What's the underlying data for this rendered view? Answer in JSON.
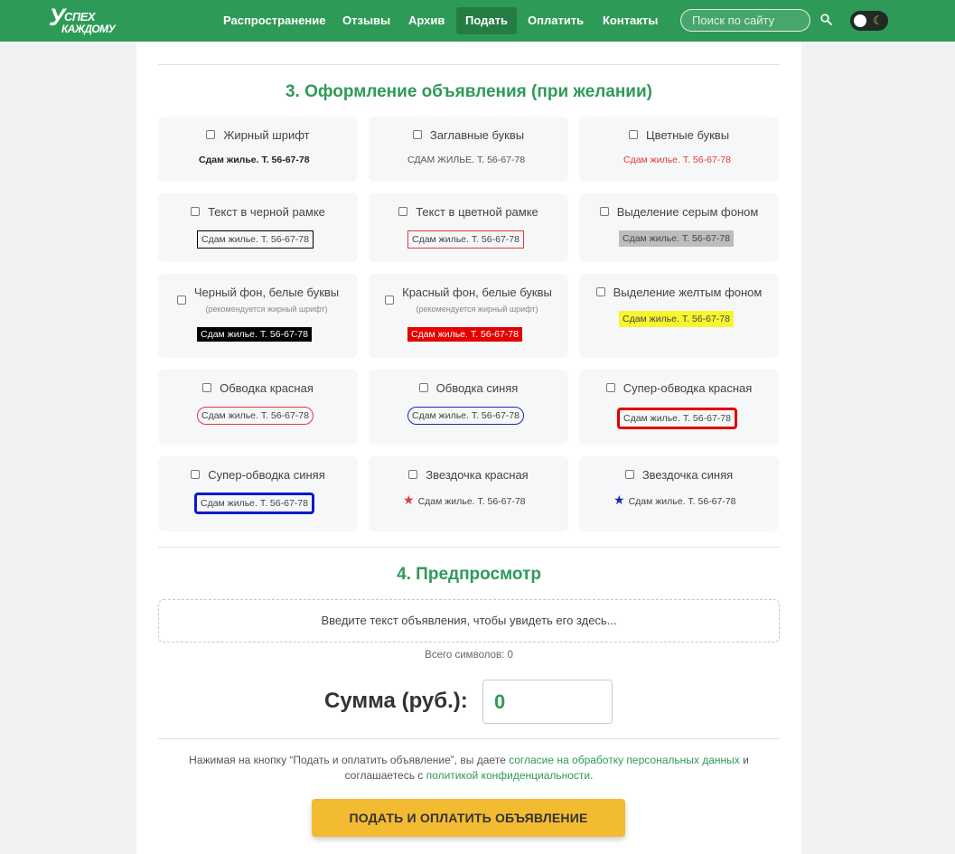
{
  "header": {
    "logo_big": "У",
    "logo_line1": "СПЕХ",
    "logo_line2": "КАЖДОМУ",
    "nav": [
      {
        "label": "Распространение",
        "active": false
      },
      {
        "label": "Отзывы",
        "active": false
      },
      {
        "label": "Архив",
        "active": false
      },
      {
        "label": "Подать",
        "active": true
      },
      {
        "label": "Оплатить",
        "active": false
      },
      {
        "label": "Контакты",
        "active": false
      }
    ],
    "search_placeholder": "Поиск по сайту",
    "search_icon": "magnifier-icon",
    "theme_icon": "moon-icon",
    "theme_toggle_on": false,
    "brand_color": "#2e9a57"
  },
  "design": {
    "title": "3. Оформление объявления (при желании)",
    "sample_text": "Сдам жилье. Т. 56-67-78",
    "sample_upper": "СДАМ ЖИЛЬЕ. Т. 56-67-78",
    "options": [
      {
        "label": "Жирный шрифт",
        "checked": false
      },
      {
        "label": "Заглавные буквы",
        "checked": false
      },
      {
        "label": "Цветные буквы",
        "checked": false
      },
      {
        "label": "Текст в черной рамке",
        "checked": false
      },
      {
        "label": "Текст в цветной рамке",
        "checked": false
      },
      {
        "label": "Выделение серым фоном",
        "checked": false
      },
      {
        "label": "Черный фон, белые буквы",
        "note": "(рекомендуется жирный шрифт)",
        "checked": false
      },
      {
        "label": "Красный фон, белые буквы",
        "note": "(рекомендуется жирный шрифт)",
        "checked": false
      },
      {
        "label": "Выделение желтым фоном",
        "checked": false
      },
      {
        "label": "Обводка красная",
        "checked": false
      },
      {
        "label": "Обводка синяя",
        "checked": false
      },
      {
        "label": "Супер-обводка красная",
        "checked": false
      },
      {
        "label": "Супер-обводка синяя",
        "checked": false
      },
      {
        "label": "Звездочка красная",
        "checked": false,
        "icon": "red-star-icon"
      },
      {
        "label": "Звездочка синяя",
        "checked": false,
        "icon": "blue-star-icon"
      }
    ],
    "star_glyph": "★"
  },
  "preview": {
    "title": "4. Предпросмотр",
    "placeholder": "Введите текст объявления, чтобы увидеть его здесь...",
    "chars_label": "Всего символов: 0"
  },
  "sum": {
    "label": "Сумма (руб.):",
    "value": "0"
  },
  "consent": {
    "part1": "Нажимая на кнопку “Подать и оплатить объявление”, вы даете ",
    "link1": "согласие на обработку персональных данных",
    "part2": " и соглашаетесь с ",
    "link2": "политикой конфиденциальности",
    "part3": "."
  },
  "submit_label": "ПОДАТЬ И ОПЛАТИТЬ ОБЪЯВЛЕНИЕ"
}
